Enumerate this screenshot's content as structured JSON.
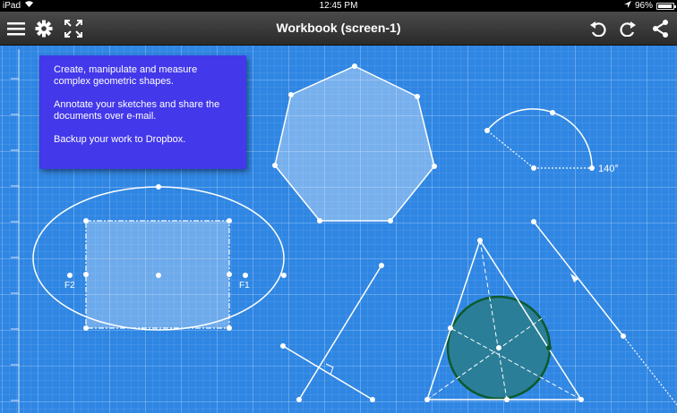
{
  "status_bar": {
    "device": "iPad",
    "time": "12:45 PM",
    "battery": "96%"
  },
  "toolbar": {
    "title": "Workbook (screen-1)",
    "icons": [
      "menu-icon",
      "gear-icon",
      "fullscreen-icon",
      "undo-icon",
      "redo-icon",
      "share-icon"
    ]
  },
  "info_box": {
    "line1": "Create, manipulate and measure complex geometric shapes.",
    "line2": "Annotate your sketches and share the documents over e-mail.",
    "line3": "Backup your work to Dropbox."
  },
  "canvas": {
    "background_color": "#2f86e3",
    "arc_angle_label": "140°",
    "focus_label_left": "F2",
    "focus_label_right": "F1"
  }
}
